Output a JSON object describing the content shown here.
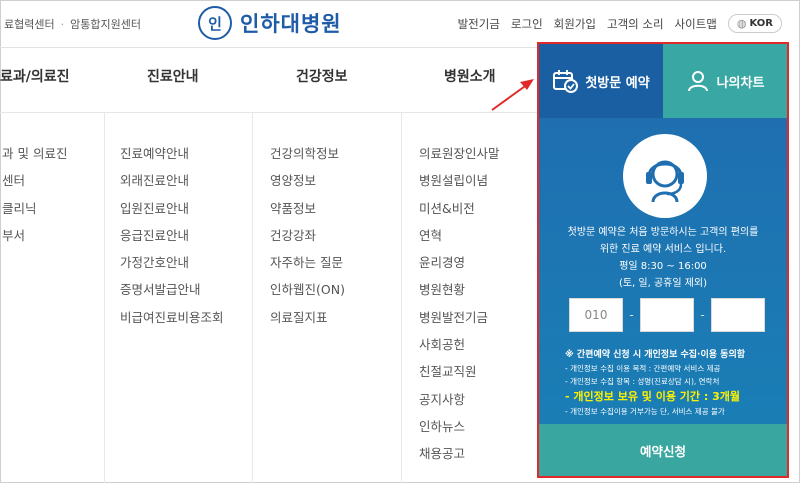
{
  "header": {
    "partner_links": [
      "료협력센터",
      "암통합지원센터"
    ],
    "logo_emblem": "인",
    "logo_text": "인하대병원",
    "util_links": [
      "발전기금",
      "로그인",
      "회원가입",
      "고객의 소리",
      "사이트맵"
    ],
    "lang": "KOR"
  },
  "nav": {
    "items": [
      "료과/의료진",
      "진료안내",
      "건강정보",
      "병원소개"
    ]
  },
  "columns": {
    "col1": [
      "과 및 의료진",
      "센터",
      "클리닉",
      "부서"
    ],
    "col2": [
      "진료예약안내",
      "외래진료안내",
      "입원진료안내",
      "응급진료안내",
      "가정간호안내",
      "증명서발급안내",
      "비급여진료비용조회"
    ],
    "col3": [
      "건강의학정보",
      "영양정보",
      "약품정보",
      "건강강좌",
      "자주하는 질문",
      "인하웹진(ON)",
      "의료질지표"
    ],
    "col4": [
      "의료원장인사말",
      "병원설립이념",
      "미션&비전",
      "연혁",
      "윤리경영",
      "병원현황",
      "병원발전기금",
      "사회공헌",
      "친절교직원",
      "공지사항",
      "인하뉴스",
      "채용공고"
    ]
  },
  "panel": {
    "tab_first": "첫방문 예약",
    "tab_chart": "나의차트",
    "desc_line1": "첫방문 예약은 처음 방문하시는 고객의 편의를",
    "desc_line2": "위한 진료 예약 서비스 입니다.",
    "hours": "평일 8:30 ~ 16:00",
    "hours_note": "(토, 일, 공휴일 제외)",
    "phone_prefix": "010",
    "notes_title": "※ 간편예약 신청 시 개인정보 수집·이용 동의함",
    "notes_1": "- 개인정보 수집 이용 목적 : 간편예약 서비스 제공",
    "notes_2": "- 개인정보 수집 항목 : 성명(진료상담 시), 연락처",
    "notes_highlight": "- 개인정보 보유 및 이용 기간 : 3개월",
    "notes_3": "- 개인정보 수집이용 거부가능 단, 서비스 제공 불가",
    "submit": "예약신청"
  },
  "colors": {
    "brand_blue": "#1f5ca8",
    "tab_blue": "#1b5fa3",
    "teal": "#39a7a4",
    "highlight_border": "#e02a2a",
    "note_highlight": "#fff200"
  },
  "icons": [
    "logo-emblem",
    "globe-icon",
    "calendar-check-icon",
    "user-icon",
    "headset-icon",
    "red-arrow"
  ]
}
